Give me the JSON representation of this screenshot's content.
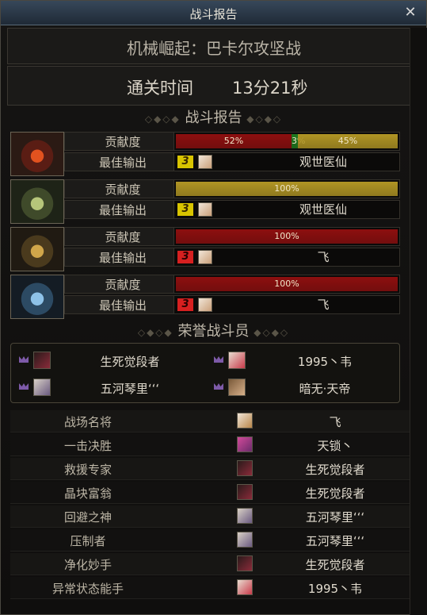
{
  "window": {
    "title": "战斗报告",
    "close": "✕"
  },
  "dungeon": {
    "name": "机械崛起：巴卡尔攻坚战"
  },
  "clear_time": {
    "label": "通关时间",
    "value": "13分21秒"
  },
  "sections": {
    "battle_report": "战斗报告",
    "honor": "荣誉战斗员"
  },
  "labels": {
    "contribution": "贡献度",
    "best_output": "最佳输出"
  },
  "players": [
    {
      "portrait": "fire-mask-icon",
      "contribution": [
        {
          "pct": 52,
          "text": "52%",
          "color": "#8d0f0f"
        },
        {
          "pct": 3,
          "text": "3%",
          "color": "#1f7a1f"
        },
        {
          "pct": 45,
          "text": "45%",
          "color": "#b09524"
        }
      ],
      "rank": "3",
      "rank_color": "#d8c400",
      "top_name": "观世医仙"
    },
    {
      "portrait": "green-mask-icon",
      "contribution": [
        {
          "pct": 100,
          "text": "100%",
          "color": "#b09524"
        }
      ],
      "rank": "3",
      "rank_color": "#d8c400",
      "top_name": "观世医仙"
    },
    {
      "portrait": "gold-mask-icon",
      "contribution": [
        {
          "pct": 100,
          "text": "100%",
          "color": "#8d0f0f"
        }
      ],
      "rank": "3",
      "rank_color": "#d62020",
      "top_name": "飞"
    },
    {
      "portrait": "blue-mask-icon",
      "contribution": [
        {
          "pct": 100,
          "text": "100%",
          "color": "#8d0f0f"
        }
      ],
      "rank": "3",
      "rank_color": "#d62020",
      "top_name": "飞"
    }
  ],
  "honor_members": [
    "生死觉段者",
    "1995丶韦",
    "五河琴里ʻʻʻ",
    "暗无·天帝"
  ],
  "awards": [
    {
      "title": "战场名将",
      "name": "飞"
    },
    {
      "title": "一击决胜",
      "name": "天锁丶"
    },
    {
      "title": "救援专家",
      "name": "生死觉段者"
    },
    {
      "title": "晶块富翁",
      "name": "生死觉段者"
    },
    {
      "title": "回避之神",
      "name": "五河琴里ʻʻʻ"
    },
    {
      "title": "压制者",
      "name": "五河琴里ʻʻʻ"
    },
    {
      "title": "净化妙手",
      "name": "生死觉段者"
    },
    {
      "title": "异常状态能手",
      "name": "1995丶韦"
    }
  ]
}
